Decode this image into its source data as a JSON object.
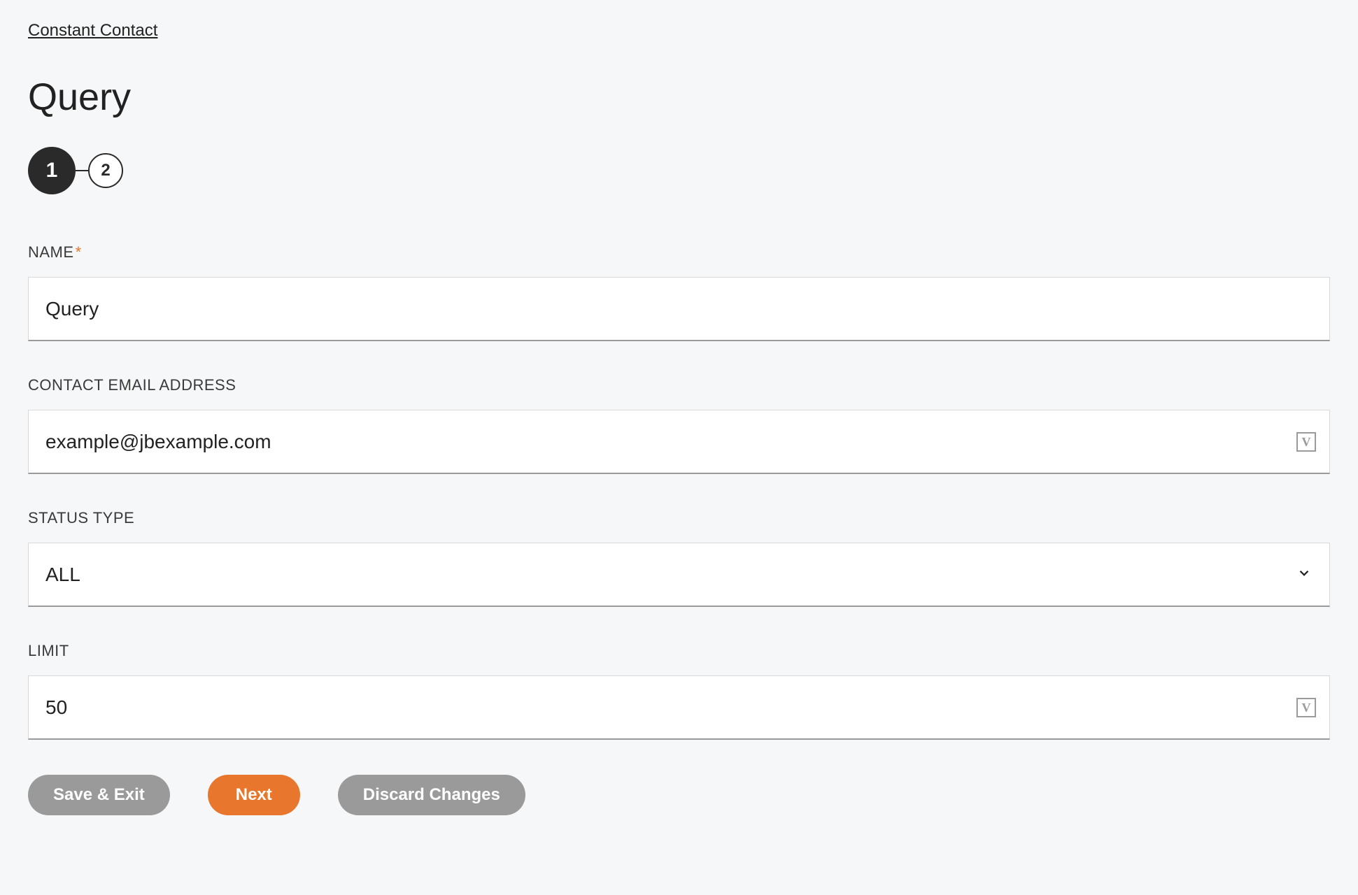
{
  "breadcrumb": {
    "label": "Constant Contact"
  },
  "page": {
    "title": "Query"
  },
  "stepper": {
    "steps": [
      "1",
      "2"
    ],
    "active_index": 0
  },
  "form": {
    "name": {
      "label": "NAME",
      "required": true,
      "value": "Query"
    },
    "email": {
      "label": "CONTACT EMAIL ADDRESS",
      "value": "example@jbexample.com"
    },
    "status": {
      "label": "STATUS TYPE",
      "selected": "ALL"
    },
    "limit": {
      "label": "LIMIT",
      "value": "50"
    }
  },
  "buttons": {
    "save_exit": "Save & Exit",
    "next": "Next",
    "discard": "Discard Changes"
  },
  "icons": {
    "variable": "V"
  }
}
